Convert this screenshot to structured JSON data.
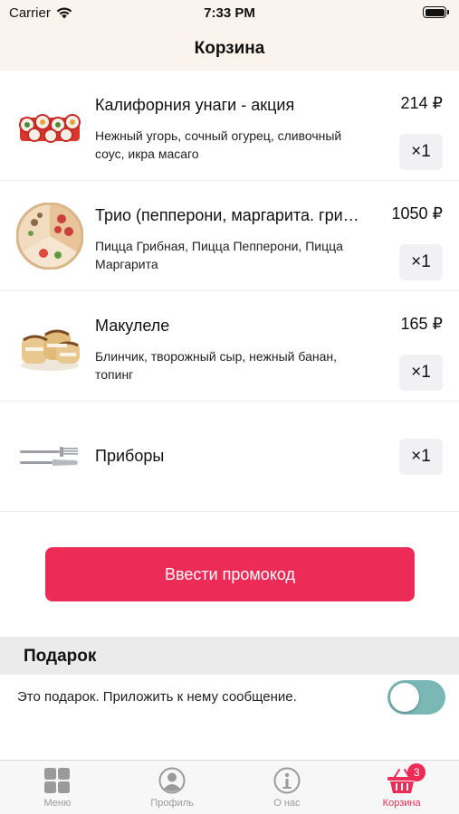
{
  "status_bar": {
    "carrier": "Carrier",
    "time": "7:33 PM"
  },
  "nav": {
    "title": "Корзина"
  },
  "cart": {
    "items": [
      {
        "name": "Калифорния унаги - акция",
        "description": "Нежный угорь, сочный огурец, сливочный соус, икра масаго",
        "price": "214 ₽",
        "quantity": "×1",
        "image": "sushi-rolls-image"
      },
      {
        "name": "Трио (пепперони, маргарита. грибная)",
        "description": "Пицца Грибная, Пицца Пепперони, Пицца Маргарита",
        "price": "1050 ₽",
        "quantity": "×1",
        "image": "pizza-image"
      },
      {
        "name": "Макулеле",
        "description": "Блинчик, творожный сыр, нежный банан, топинг",
        "price": "165 ₽",
        "quantity": "×1",
        "image": "pancake-rolls-image"
      }
    ],
    "cutlery": {
      "name": "Приборы",
      "quantity": "×1",
      "icon": "cutlery-icon"
    }
  },
  "promo": {
    "button_label": "Ввести промокод"
  },
  "gift": {
    "title": "Подарок",
    "text": "Это подарок. Приложить к нему сообщение.",
    "toggle_on": false
  },
  "tab_bar": {
    "tabs": [
      {
        "label": "Меню",
        "icon": "menu-grid-icon",
        "active": false
      },
      {
        "label": "Профиль",
        "icon": "profile-icon",
        "active": false
      },
      {
        "label": "О нас",
        "icon": "about-icon",
        "active": false
      },
      {
        "label": "Корзина",
        "icon": "basket-icon",
        "active": true,
        "badge": "3"
      }
    ]
  },
  "colors": {
    "accent": "#ec2b57",
    "header_bg": "#fbf3ee",
    "toggle_track": "#7ab8b6",
    "inactive_tab": "#9a9a9a"
  }
}
